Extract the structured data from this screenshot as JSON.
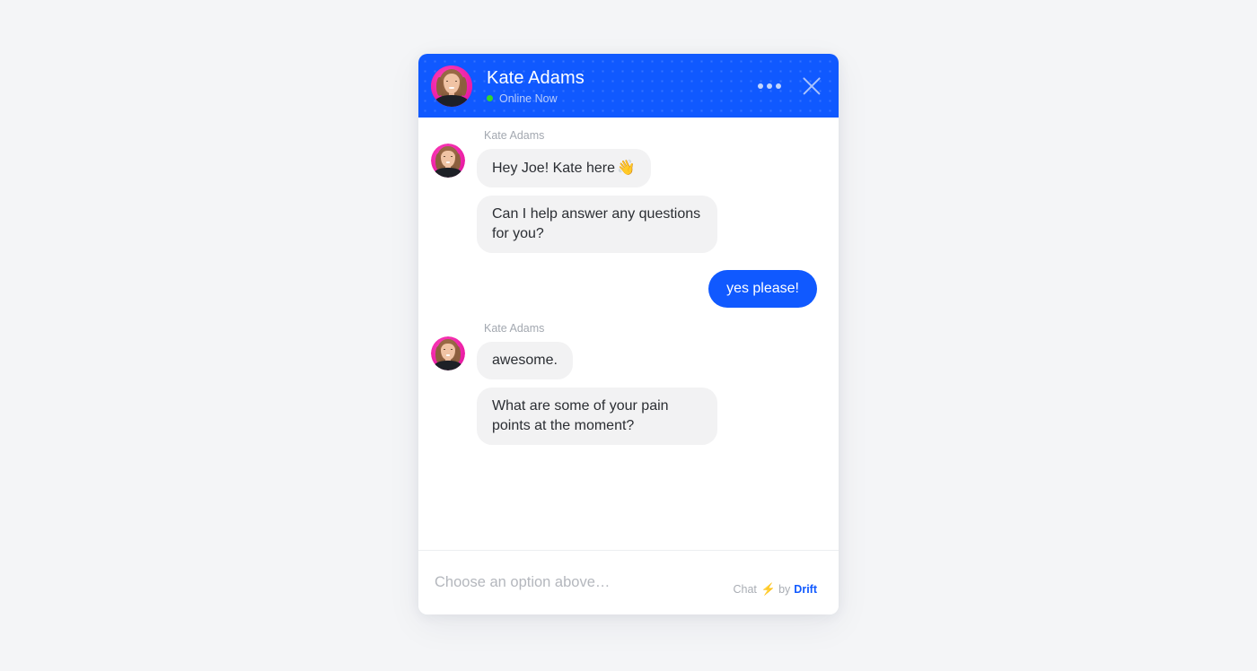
{
  "page": {
    "background_color": "#f4f5f7"
  },
  "widget": {
    "accent_color": "#1059ff",
    "bubble_incoming_color": "#f2f2f3",
    "header": {
      "agent_name": "Kate Adams",
      "status_label": "Online Now",
      "status_color": "#35d62b",
      "avatar_icon": "agent-photo-avatar",
      "menu_icon": "more-options-icon",
      "close_icon": "close-icon"
    },
    "conversation": [
      {
        "type": "incoming",
        "sender": "Kate Adams",
        "avatar_icon": "agent-photo-avatar",
        "messages": [
          {
            "text": "Hey Joe! Kate here",
            "emoji": "👋"
          },
          {
            "text": "Can I help answer any questions for you?",
            "emoji": ""
          }
        ]
      },
      {
        "type": "outgoing",
        "messages": [
          {
            "text": "yes please!",
            "emoji": ""
          }
        ]
      },
      {
        "type": "incoming",
        "sender": "Kate Adams",
        "avatar_icon": "agent-photo-avatar",
        "messages": [
          {
            "text": "awesome.",
            "emoji": ""
          },
          {
            "text": "What are some of your pain points at the moment?",
            "emoji": ""
          }
        ]
      }
    ],
    "footer": {
      "input_value": "",
      "input_placeholder": "Choose an option above…",
      "brand_prefix": "Chat",
      "brand_bolt_icon": "⚡",
      "brand_middle": "by",
      "brand_name": "Drift",
      "brand_color": "#1059ff",
      "bolt_color": "#ffc42e"
    }
  }
}
